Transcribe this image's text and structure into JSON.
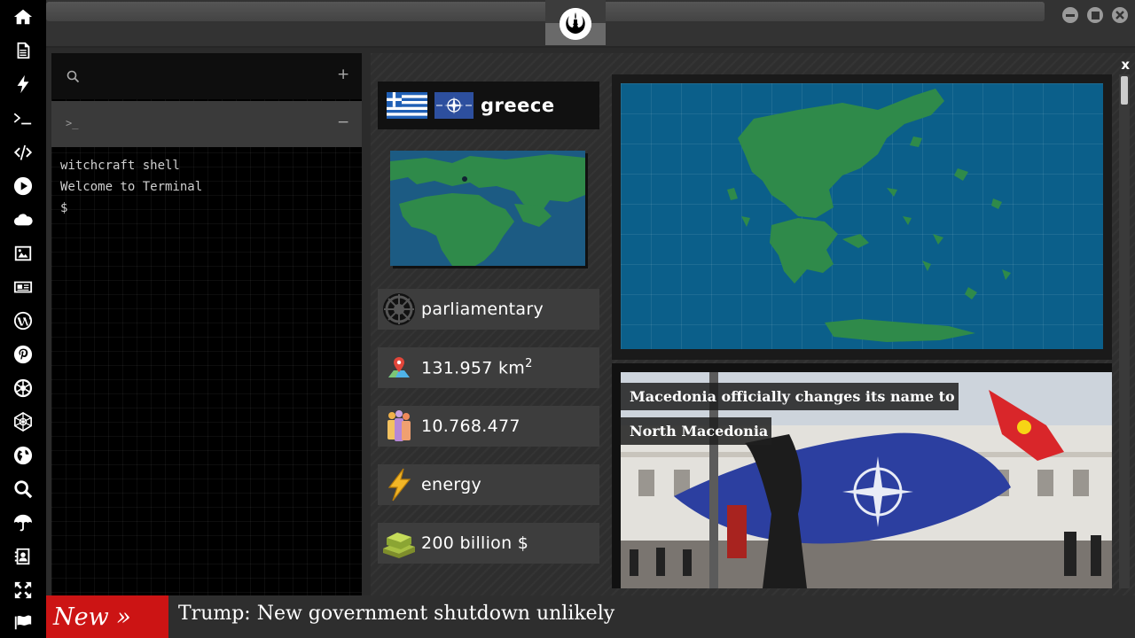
{
  "sidebar": {
    "items": [
      {
        "name": "home-icon"
      },
      {
        "name": "document-icon"
      },
      {
        "name": "lightning-icon"
      },
      {
        "name": "terminal-icon"
      },
      {
        "name": "code-icon"
      },
      {
        "name": "play-icon"
      },
      {
        "name": "cloud-icon"
      },
      {
        "name": "image-icon"
      },
      {
        "name": "newspaper-icon"
      },
      {
        "name": "wordpress-icon"
      },
      {
        "name": "pinterest-icon"
      },
      {
        "name": "aperture-icon"
      },
      {
        "name": "network-icon"
      },
      {
        "name": "globe-icon"
      },
      {
        "name": "search-icon"
      },
      {
        "name": "umbrella-icon"
      },
      {
        "name": "contact-icon"
      },
      {
        "name": "expand-icon"
      },
      {
        "name": "flag-icon"
      }
    ]
  },
  "window": {
    "logo": "rebel-alliance-icon",
    "controls": [
      "minimize-icon",
      "maximize-icon",
      "close-icon"
    ]
  },
  "terminal": {
    "search_icon": "search-icon",
    "add_label": "+",
    "prompt_icon": ">_",
    "collapse_label": "−",
    "lines": [
      "witchcraft shell",
      "Welcome to Terminal",
      "$"
    ]
  },
  "country": {
    "close_label": "x",
    "name": "greece",
    "flags": [
      "greece-flag-icon",
      "nato-flag-icon"
    ],
    "government": "parliamentary",
    "area_value": "131.957 km",
    "area_exponent": "2",
    "population": "10.768.477",
    "sector": "energy",
    "gdp": "200 billion $"
  },
  "news": {
    "headline": "Macedonia officially changes its name to North Macedonia"
  },
  "ticker": {
    "badge": "New »",
    "text": "Trump: New government shutdown unlikely"
  },
  "colors": {
    "accent_red": "#cc1414",
    "map_sea": "#0b5f8a",
    "map_land": "#2f8a4a"
  }
}
